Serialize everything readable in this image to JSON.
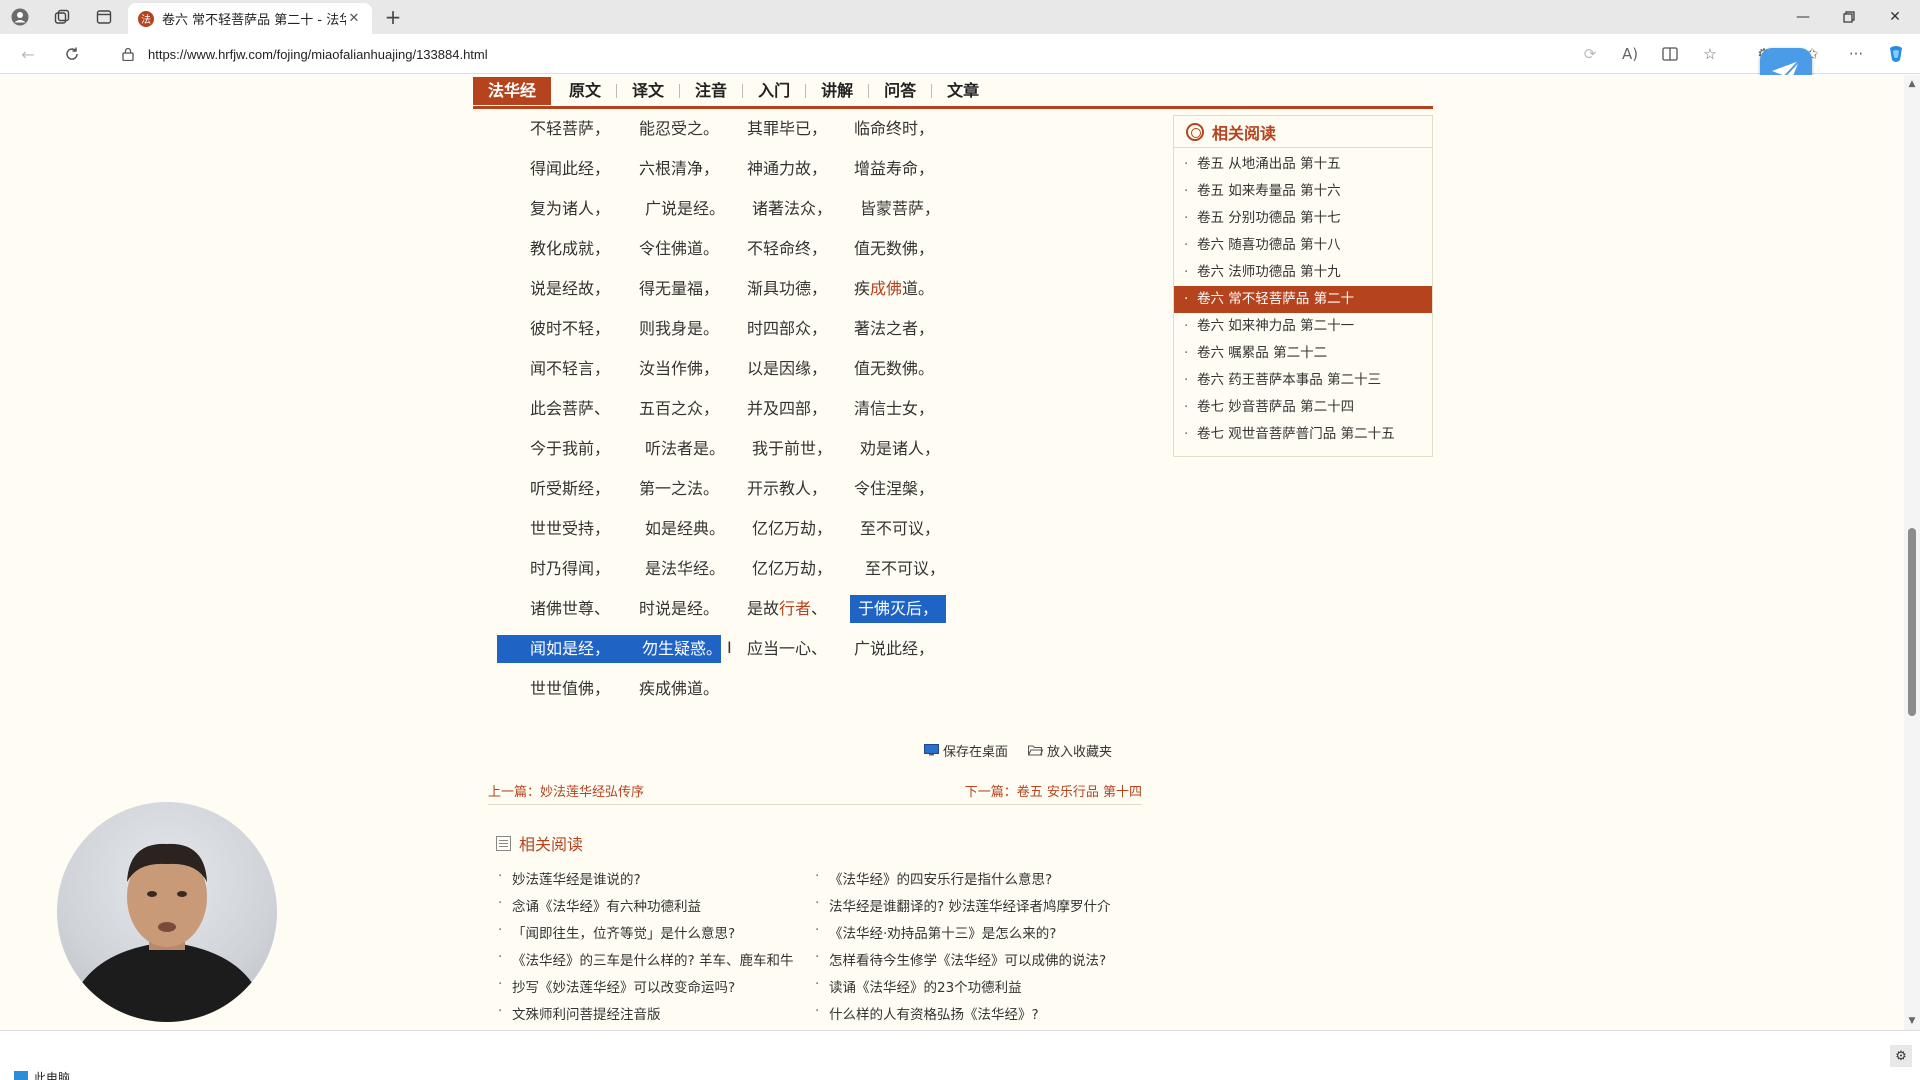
{
  "browser": {
    "tab_title": "卷六 常不轻菩萨品 第二十 - 法华",
    "tab_favicon": "法",
    "url": "https://www.hrfjw.com/fojing/miaofalianhuajing/133884.html"
  },
  "subnav": {
    "items": [
      "法华经",
      "原文",
      "译文",
      "注音",
      "入门",
      "讲解",
      "问答",
      "文章"
    ]
  },
  "verses": [
    [
      "不轻菩萨，",
      "能忍受之。",
      "其罪毕已，",
      "临命终时，"
    ],
    [
      "得闻此经，",
      "六根清净，",
      "神通力故，",
      "增益寿命，"
    ],
    [
      "复为诸人，",
      "广说是经。",
      "诸著法众，",
      "皆蒙菩萨，"
    ],
    [
      "教化成就，",
      "令住佛道。",
      "不轻命终，",
      "值无数佛，"
    ],
    [
      "说是经故，",
      "得无量福，",
      "渐具功德，",
      "疾成佛道。"
    ],
    [
      "彼时不轻，",
      "则我身是。",
      "时四部众，",
      "著法之者，"
    ],
    [
      "闻不轻言，",
      "汝当作佛，",
      "以是因缘，",
      "值无数佛。"
    ],
    [
      "此会菩萨、",
      "五百之众，",
      "并及四部，",
      "清信士女，"
    ],
    [
      "今于我前，",
      "听法者是。",
      "我于前世，",
      "劝是诸人，"
    ],
    [
      "听受斯经，",
      "第一之法。",
      "开示教人，",
      "令住涅槃，"
    ],
    [
      "世世受持，",
      "如是经典。",
      "亿亿万劫，",
      "至不可议，"
    ],
    [
      "时乃得闻，",
      "是法华经。",
      "亿亿万劫，",
      "至不可议，"
    ],
    [
      "诸佛世尊、",
      "时说是经。",
      "是故行者、",
      "于佛灭后，"
    ],
    [
      "闻如是经，",
      "勿生疑惑。",
      "应当一心、",
      "广说此经，"
    ],
    [
      "世世值佛，",
      "疾成佛道。",
      "",
      ""
    ]
  ],
  "actions": {
    "save_desktop": "保存在桌面",
    "add_favorites": "放入收藏夹"
  },
  "prevnext": {
    "prev_label": "上一篇：",
    "prev_title": "妙法莲华经弘传序",
    "next_label": "下一篇：",
    "next_title": "卷五 安乐行品 第十四"
  },
  "related_bottom": {
    "title": "相关阅读",
    "left": [
      "妙法莲华经是谁说的?",
      "念诵《法华经》有六种功德利益",
      "「闻即往生，位齐等觉」是什么意思?",
      "《法华经》的三车是什么样的? 羊车、鹿车和牛",
      "抄写《妙法莲华经》可以改变命运吗?",
      "文殊师利问菩提经注音版"
    ],
    "right": [
      "《法华经》的四安乐行是指什么意思?",
      "法华经是谁翻译的? 妙法莲华经译者鸠摩罗什介",
      "《法华经·劝持品第十三》是怎么来的?",
      "怎样看待今生修学《法华经》可以成佛的说法?",
      "读诵《法华经》的23个功德利益",
      "什么样的人有资格弘扬《法华经》?"
    ]
  },
  "related_side": {
    "title": "相关阅读",
    "items": [
      "卷五 从地涌出品 第十五",
      "卷五 如来寿量品 第十六",
      "卷五 分别功德品 第十七",
      "卷六 随喜功德品 第十八",
      "卷六 法师功德品 第十九",
      "卷六 常不轻菩萨品 第二十",
      "卷六 如来神力品 第二十一",
      "卷六 嘱累品 第二十二",
      "卷六 药王菩萨本事品 第二十三",
      "卷七 妙音菩萨品 第二十四",
      "卷七 观世音菩萨普门品 第二十五"
    ],
    "active_index": 5
  },
  "taskbar": {
    "item_label": "此电脑"
  },
  "colors": {
    "accent": "#b4431e",
    "selection": "#1f63c5",
    "page_bg": "#fffdf3"
  }
}
